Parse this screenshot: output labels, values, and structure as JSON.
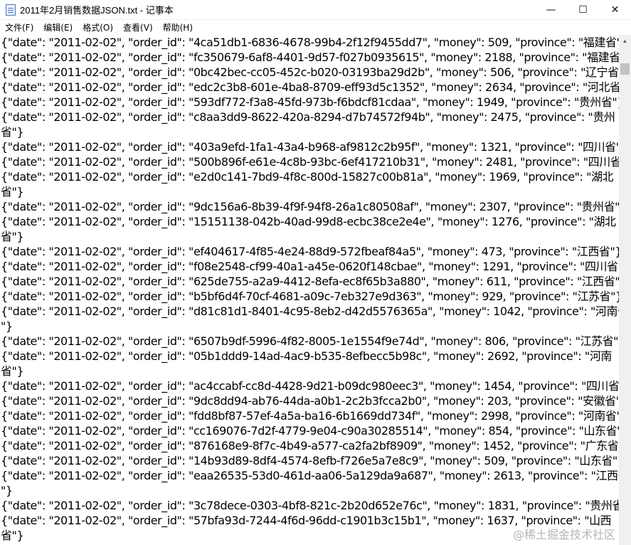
{
  "window": {
    "title": "2011年2月销售数据JSON.txt - 记事本",
    "minimize_glyph": "—",
    "maximize_glyph": "☐",
    "close_glyph": "✕"
  },
  "menu": [
    {
      "label": "文件(F)"
    },
    {
      "label": "编辑(E)"
    },
    {
      "label": "格式(O)"
    },
    {
      "label": "查看(V)"
    },
    {
      "label": "帮助(H)"
    }
  ],
  "lines": [
    "{\"date\": \"2011-02-02\", \"order_id\": \"4ca51db1-6836-4678-99b4-2f12f9455dd7\", \"money\": 509, \"province\": \"福建省\"}",
    "{\"date\": \"2011-02-02\", \"order_id\": \"fc350679-6af8-4401-9d57-f027b0935615\", \"money\": 2188, \"province\": \"福建省\"}",
    "{\"date\": \"2011-02-02\", \"order_id\": \"0bc42bec-cc05-452c-b020-03193ba29d2b\", \"money\": 506, \"province\": \"辽宁省\"}",
    "{\"date\": \"2011-02-02\", \"order_id\": \"edc2c3b8-601e-4ba8-8709-eff93d5c1352\", \"money\": 2634, \"province\": \"河北省\"}",
    "{\"date\": \"2011-02-02\", \"order_id\": \"593df772-f3a8-45fd-973b-f6bdcf81cdaa\", \"money\": 1949, \"province\": \"贵州省\"}",
    "{\"date\": \"2011-02-02\", \"order_id\": \"c8aa3dd9-8622-420a-8294-d7b74572f94b\", \"money\": 2475, \"province\": \"贵州",
    "省\"}",
    "{\"date\": \"2011-02-02\", \"order_id\": \"403a9efd-1fa1-43a4-b968-af9812c2b95f\", \"money\": 1321, \"province\": \"四川省\"}",
    "{\"date\": \"2011-02-02\", \"order_id\": \"500b896f-e61e-4c8b-93bc-6ef417210b31\", \"money\": 2481, \"province\": \"四川省\"}",
    "{\"date\": \"2011-02-02\", \"order_id\": \"e2d0c141-7bd9-4f8c-800d-15827c00b81a\", \"money\": 1969, \"province\": \"湖北",
    "省\"}",
    "{\"date\": \"2011-02-02\", \"order_id\": \"9dc156a6-8b39-4f9f-94f8-26a1c80508af\", \"money\": 2307, \"province\": \"贵州省\"}",
    "{\"date\": \"2011-02-02\", \"order_id\": \"15151138-042b-40ad-99d8-ecbc38ce2e4e\", \"money\": 1276, \"province\": \"湖北",
    "省\"}",
    "{\"date\": \"2011-02-02\", \"order_id\": \"ef404617-4f85-4e24-88d9-572fbeaf84a5\", \"money\": 473, \"province\": \"江西省\"}",
    "{\"date\": \"2011-02-02\", \"order_id\": \"f08e2548-cf99-40a1-a45e-0620f148cbae\", \"money\": 1291, \"province\": \"四川省\"}",
    "{\"date\": \"2011-02-02\", \"order_id\": \"625de755-a2a9-4412-8efa-ec8f65b3a880\", \"money\": 611, \"province\": \"江西省\"}",
    "{\"date\": \"2011-02-02\", \"order_id\": \"b5bf6d4f-70cf-4681-a09c-7eb327e9d363\", \"money\": 929, \"province\": \"江苏省\"}",
    "{\"date\": \"2011-02-02\", \"order_id\": \"d81c81d1-8401-4c95-8eb2-d42d5576365a\", \"money\": 1042, \"province\": \"河南省",
    "\"}",
    "{\"date\": \"2011-02-02\", \"order_id\": \"6507b9df-5996-4f82-8005-1e1554f9e74d\", \"money\": 806, \"province\": \"江苏省\"}",
    "{\"date\": \"2011-02-02\", \"order_id\": \"05b1ddd9-14ad-4ac9-b535-8efbecc5b98c\", \"money\": 2692, \"province\": \"河南",
    "省\"}",
    "{\"date\": \"2011-02-02\", \"order_id\": \"ac4ccabf-cc8d-4428-9d21-b09dc980eec3\", \"money\": 1454, \"province\": \"四川省\"}",
    "{\"date\": \"2011-02-02\", \"order_id\": \"9dc8dd94-ab76-44da-a0b1-2c2b3fcca2b0\", \"money\": 203, \"province\": \"安徽省\"}",
    "{\"date\": \"2011-02-02\", \"order_id\": \"fdd8bf87-57ef-4a5a-ba16-6b1669dd734f\", \"money\": 2998, \"province\": \"河南省\"}",
    "{\"date\": \"2011-02-02\", \"order_id\": \"cc169076-7d2f-4779-9e04-c90a30285514\", \"money\": 854, \"province\": \"山东省\"}",
    "{\"date\": \"2011-02-02\", \"order_id\": \"876168e9-8f7c-4b49-a577-ca2fa2bf8909\", \"money\": 1452, \"province\": \"广东省\"}",
    "{\"date\": \"2011-02-02\", \"order_id\": \"14b93d89-8df4-4574-8efb-f726e5a7e8c9\", \"money\": 509, \"province\": \"山东省\"}",
    "{\"date\": \"2011-02-02\", \"order_id\": \"eaa26535-53d0-461d-aa06-5a129da9a687\", \"money\": 2613, \"province\": \"江西省",
    "\"}",
    "{\"date\": \"2011-02-02\", \"order_id\": \"3c78dece-0303-4bf8-821c-2b20d652e76c\", \"money\": 1831, \"province\": \"贵州省\"}",
    "{\"date\": \"2011-02-02\", \"order_id\": \"57bfa93d-7244-4f6d-96dd-c1901b3c15b1\", \"money\": 1637, \"province\": \"山西",
    "省\"}"
  ],
  "watermark": "@稀土掘金技术社区",
  "scrollbar": {
    "up_glyph": "▲"
  }
}
